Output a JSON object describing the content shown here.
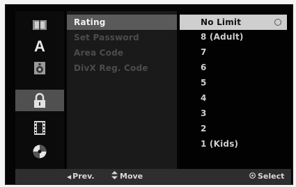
{
  "sidebar": {
    "icons": [
      {
        "name": "disc-menu-icon",
        "selected": false
      },
      {
        "name": "language-icon",
        "glyph": "A",
        "selected": false
      },
      {
        "name": "audio-icon",
        "selected": false
      },
      {
        "name": "lock-icon",
        "selected": true
      },
      {
        "name": "film-icon",
        "selected": false
      },
      {
        "name": "disc-icon",
        "selected": false
      }
    ]
  },
  "menu": {
    "items": [
      {
        "label": "Rating",
        "selected": true
      },
      {
        "label": "Set Password",
        "selected": false
      },
      {
        "label": "Area Code",
        "selected": false
      },
      {
        "label": "DivX Reg. Code",
        "selected": false
      }
    ]
  },
  "options": {
    "items": [
      {
        "label": "No Limit",
        "selected": true
      },
      {
        "label": "8  (Adult)"
      },
      {
        "label": "7"
      },
      {
        "label": "6"
      },
      {
        "label": "5"
      },
      {
        "label": "4"
      },
      {
        "label": "3"
      },
      {
        "label": "2"
      },
      {
        "label": "1  (Kids)"
      }
    ]
  },
  "footer": {
    "prev": "Prev.",
    "move": "Move",
    "select": "Select"
  }
}
